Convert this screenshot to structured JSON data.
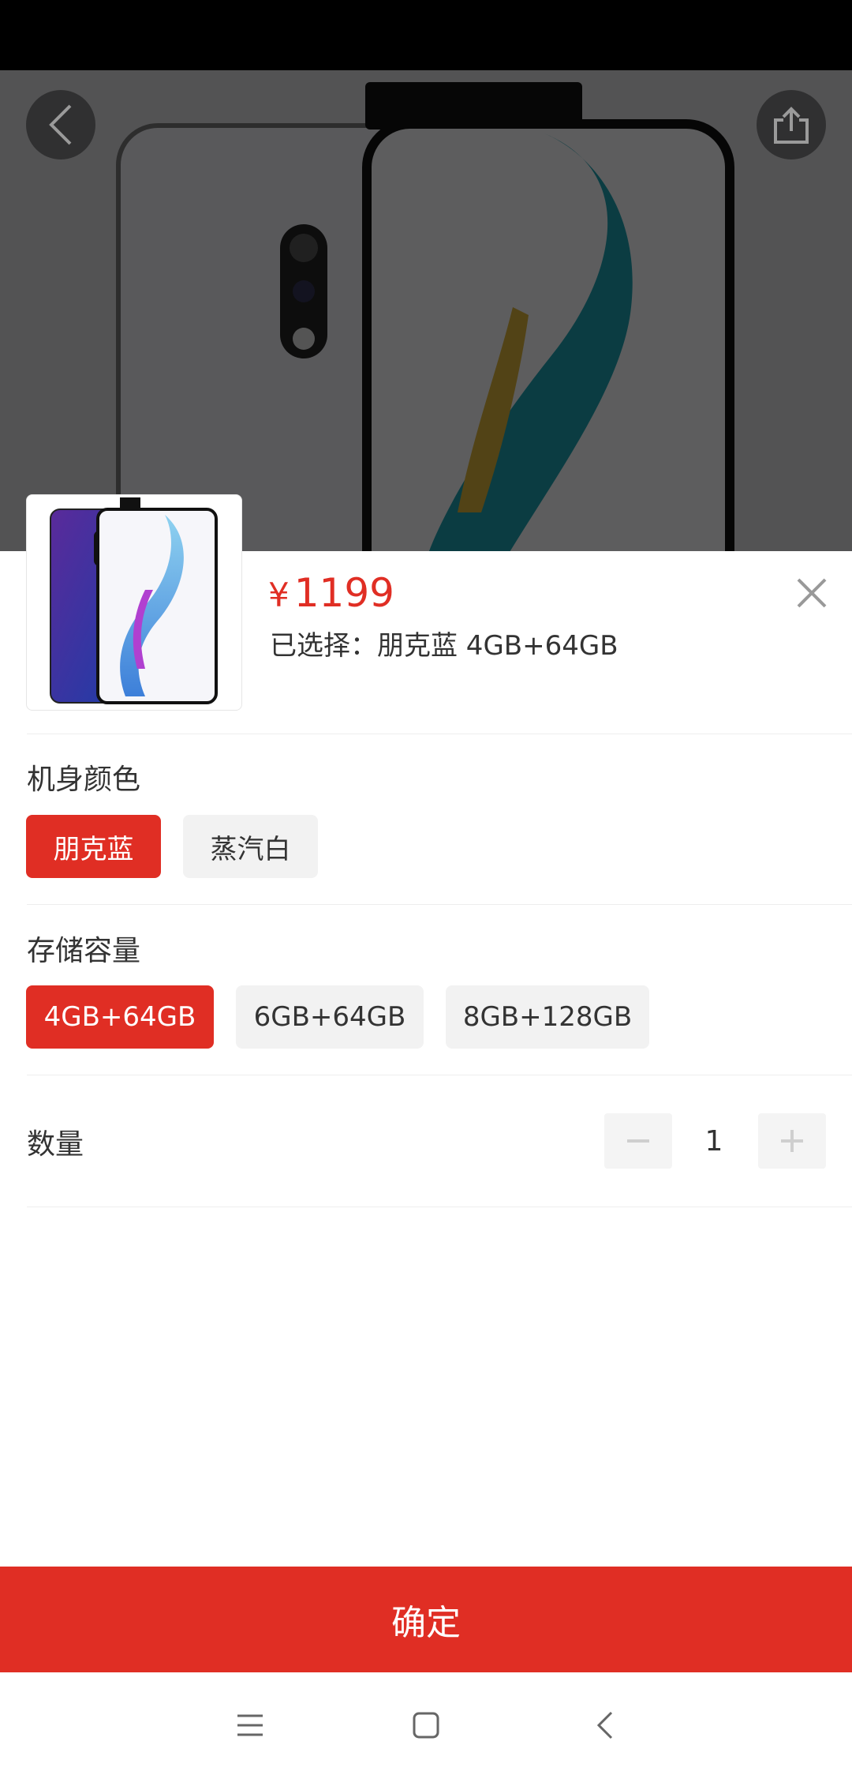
{
  "icons": {
    "back": "chevron-left-icon",
    "share": "share-icon",
    "close": "close-icon",
    "minus": "minus-icon",
    "plus": "plus-icon",
    "menu": "menu-icon",
    "home": "home-icon",
    "nav_back": "back-icon"
  },
  "colors": {
    "accent": "#e02e24",
    "option_bg": "#f2f2f2",
    "divider": "#eeeeee"
  },
  "product": {
    "price_symbol": "¥",
    "price": "1199",
    "selected_text": "已选择：朋克蓝 4GB+64GB"
  },
  "color_section": {
    "title": "机身颜色",
    "options": [
      {
        "label": "朋克蓝",
        "selected": true
      },
      {
        "label": "蒸汽白",
        "selected": false
      }
    ]
  },
  "storage_section": {
    "title": "存储容量",
    "options": [
      {
        "label": "4GB+64GB",
        "selected": true
      },
      {
        "label": "6GB+64GB",
        "selected": false
      },
      {
        "label": "8GB+128GB",
        "selected": false
      }
    ]
  },
  "quantity": {
    "label": "数量",
    "value": "1"
  },
  "confirm_label": "确定"
}
